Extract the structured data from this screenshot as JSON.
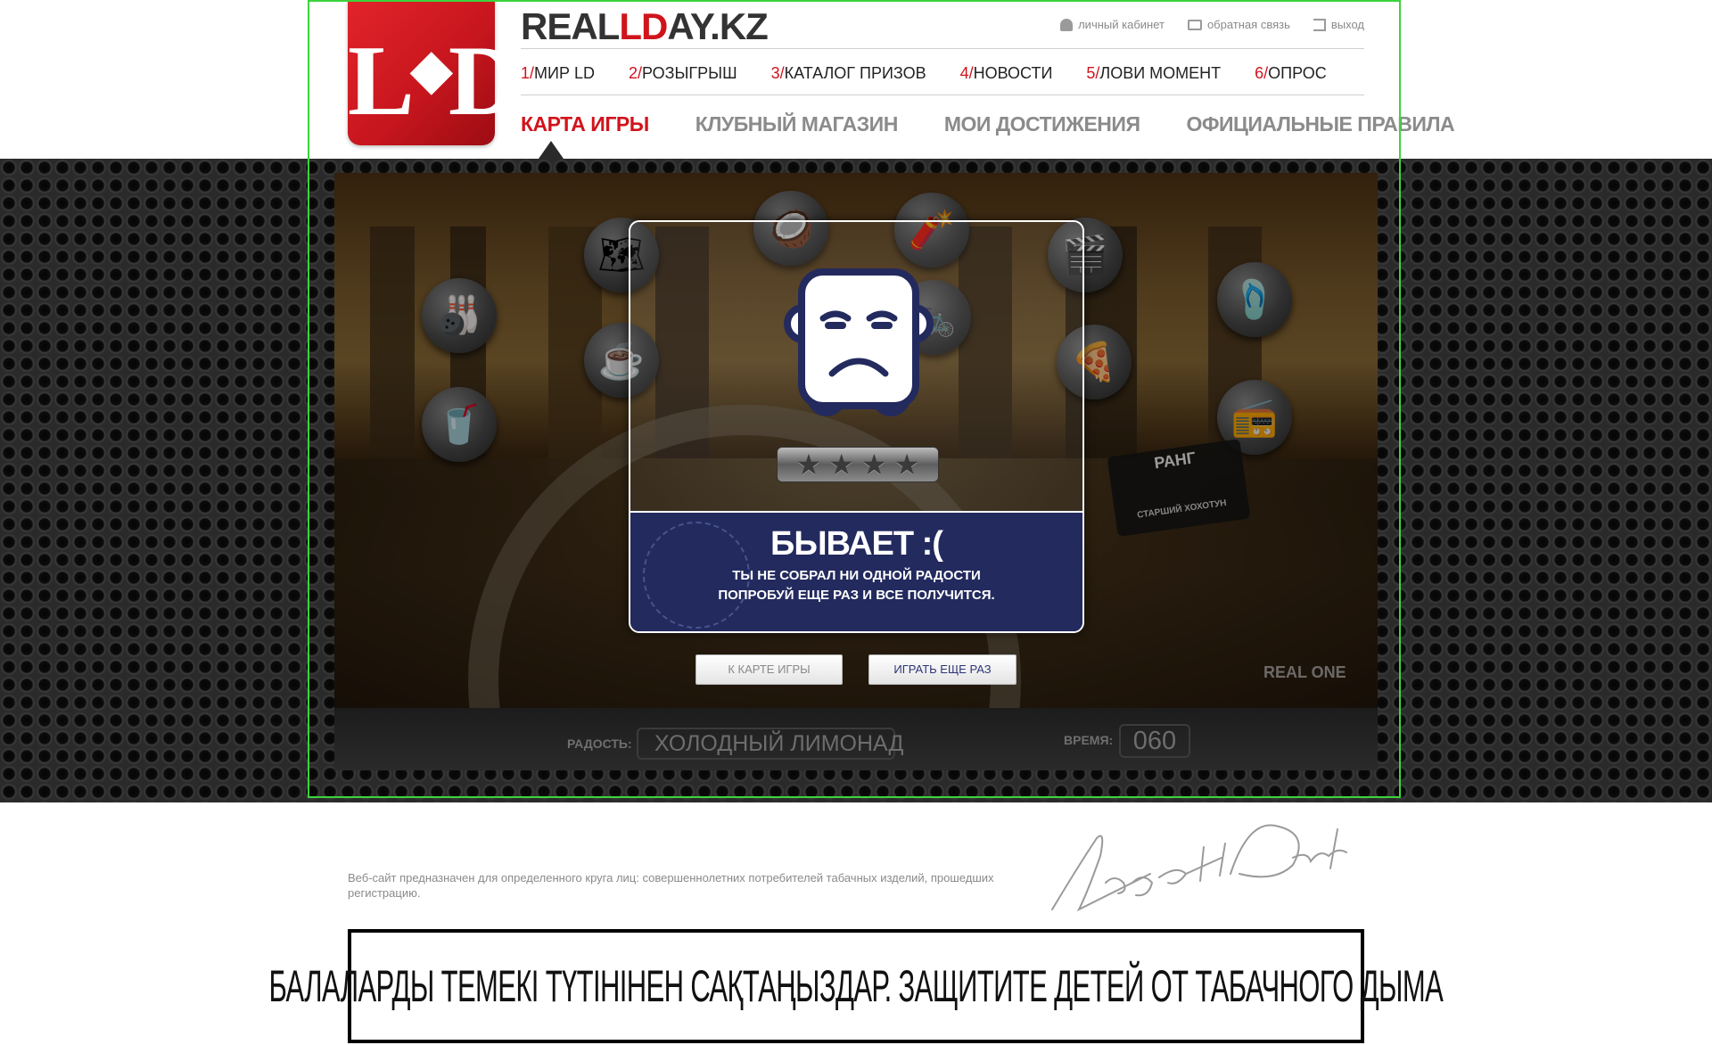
{
  "header": {
    "logo": "L·D",
    "site_title_prefix": "REAL",
    "site_title_mid": "LD",
    "site_title_suffix": "AY.KZ",
    "user_links": [
      "личный кабинет",
      "обратная связь",
      "выход"
    ]
  },
  "nav_primary": [
    {
      "num": "1/",
      "label": "МИР LD"
    },
    {
      "num": "2/",
      "label": "РОЗЫГРЫШ"
    },
    {
      "num": "3/",
      "label": "КАТАЛОГ ПРИЗОВ"
    },
    {
      "num": "4/",
      "label": "НОВОСТИ"
    },
    {
      "num": "5/",
      "label": "ЛОВИ МОМЕНТ"
    },
    {
      "num": "6/",
      "label": "ОПРОС"
    }
  ],
  "nav_secondary": {
    "active": "КАРТА ИГРЫ",
    "items": [
      "КЛУБНЫЙ МАГАЗИН",
      "МОИ ДОСТИЖЕНИЯ",
      "ОФИЦИАЛЬНЫЕ ПРАВИЛА"
    ]
  },
  "scene": {
    "rank_title": "РАНГ",
    "rank_subtitle": "СТАРШИЙ ХОХОТУН",
    "brand_stamp": "REAL ONE",
    "props": [
      "bowling-icon",
      "map-icon",
      "coconut-icon",
      "dynamite-icon",
      "clapper-icon",
      "slippers-icon",
      "coffee-icon",
      "bicycle-icon",
      "pizza-icon",
      "lemonade-icon",
      "radio-icon"
    ]
  },
  "modal": {
    "title": "БЫВАЕТ :(",
    "message_line1": "ТЫ НЕ СОБРАЛ НИ ОДНОЙ РАДОСТИ",
    "message_line2": "ПОПРОБУЙ ЕЩЕ РАЗ И ВСЕ ПОЛУЧИТСЯ.",
    "stars_earned": 0,
    "stars_total": 4
  },
  "buttons": {
    "to_map": "К КАРТЕ ИГРЫ",
    "play_again": "ИГРАТЬ ЕЩЕ РАЗ"
  },
  "status": {
    "joy_label": "РАДОСТЬ:",
    "joy_value": "ХОЛОДНЫЙ ЛИМОНАД",
    "time_label": "ВРЕМЯ:",
    "time_value": "060"
  },
  "footer": {
    "disclaimer": "Веб-сайт предназначен для определенного круга лиц: совершеннолетних потребителей табачных изделий, прошедших регистрацию.",
    "signature": "Liggett Ducat",
    "warning": "БАЛАЛАРДЫ ТЕМЕКІ ТҮТІНІНЕН САҚТАҢЫЗДАР. ЗАЩИТИТЕ ДЕТЕЙ ОТ ТАБАЧНОГО ДЫМА"
  },
  "colors": {
    "brand_red": "#d0141c",
    "modal_blue": "#232a5e"
  }
}
